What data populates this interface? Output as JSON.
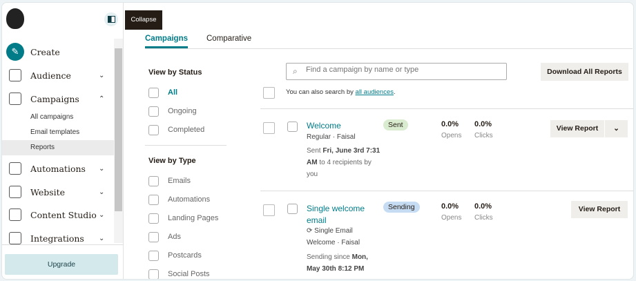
{
  "sidebar": {
    "collapse_tooltip": "Collapse",
    "items": [
      {
        "label": "Create"
      },
      {
        "label": "Audience"
      },
      {
        "label": "Campaigns"
      },
      {
        "label": "Automations"
      },
      {
        "label": "Website"
      },
      {
        "label": "Content Studio"
      },
      {
        "label": "Integrations"
      }
    ],
    "campaigns_sub": [
      "All campaigns",
      "Email templates",
      "Reports"
    ],
    "upgrade": "Upgrade"
  },
  "tabs": [
    "Campaigns",
    "Comparative"
  ],
  "filters": {
    "status_title": "View by Status",
    "status": [
      "All",
      "Ongoing",
      "Completed"
    ],
    "type_title": "View by Type",
    "types": [
      "Emails",
      "Automations",
      "Landing Pages",
      "Ads",
      "Postcards",
      "Social Posts"
    ]
  },
  "search": {
    "placeholder": "Find a campaign by name or type",
    "hint": "You can also search by",
    "hint_link": "all audiences",
    "hint_end": "."
  },
  "download_all": "Download All Reports",
  "campaigns": [
    {
      "name": "Welcome",
      "status": "Sent",
      "meta": "Regular · Faisal",
      "detail_pre": "Sent ",
      "detail_bold": "Fri, June 3rd 7:31 AM",
      "detail_post": " to 4 recipients by you",
      "opens": "0.0%",
      "opens_label": "Opens",
      "clicks": "0.0%",
      "clicks_label": "Clicks",
      "button": "View Report"
    },
    {
      "name": "Single welcome email",
      "status": "Sending",
      "type": "Single Email",
      "meta": "Welcome · Faisal",
      "detail_pre": "Sending since ",
      "detail_bold": "Mon, May 30th 8:12 PM",
      "opens": "0.0%",
      "opens_label": "Opens",
      "clicks": "0.0%",
      "clicks_label": "Clicks",
      "button": "View Report"
    }
  ],
  "colors": {
    "accent": "#007c89",
    "sent": "#d9eccf",
    "sending": "#c5dcf2"
  }
}
